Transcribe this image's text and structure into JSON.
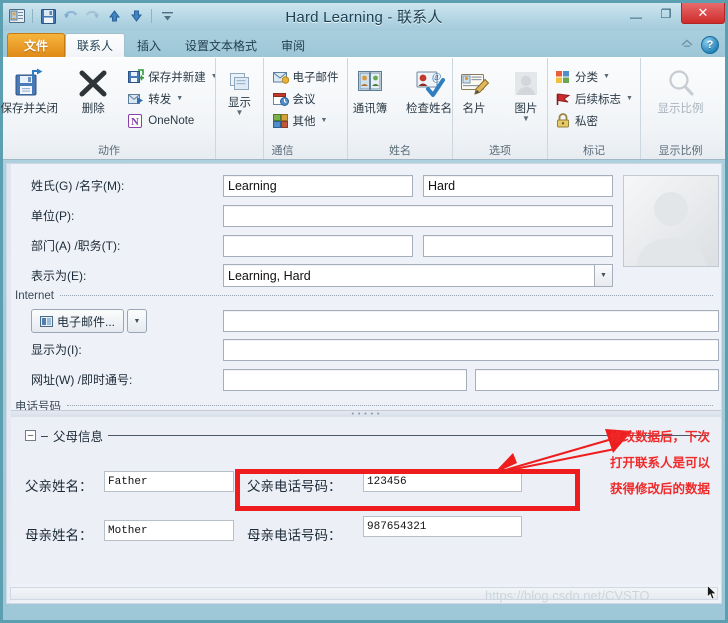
{
  "window": {
    "title": "Hard Learning - 联系人",
    "minimize_label": "—",
    "maximize_label": "❐",
    "close_label": "✕"
  },
  "quick_access": {
    "icons": [
      "contact-card-icon",
      "save-icon",
      "undo-icon",
      "redo-icon",
      "up-arrow-icon",
      "down-arrow-icon",
      "customize-qat-icon"
    ]
  },
  "tabs": [
    {
      "label": "文件",
      "kind": "file"
    },
    {
      "label": "联系人",
      "kind": "active"
    },
    {
      "label": "插入",
      "kind": "normal"
    },
    {
      "label": "设置文本格式",
      "kind": "normal"
    },
    {
      "label": "审阅",
      "kind": "normal"
    }
  ],
  "tab_right": {
    "minimize_ribbon_icon": "minimize-ribbon-icon",
    "help_label": "?"
  },
  "ribbon": {
    "groups": [
      {
        "name": "动作",
        "big_buttons": [
          {
            "label": "保存并关闭",
            "icon": "save-and-close-icon"
          },
          {
            "label": "删除",
            "icon": "delete-x-icon"
          }
        ],
        "small_buttons": [
          {
            "label": "保存并新建",
            "icon": "save-new-icon",
            "caret": true
          },
          {
            "label": "转发",
            "icon": "forward-icon",
            "caret": true
          },
          {
            "label": "OneNote",
            "icon": "onenote-icon",
            "caret": false
          }
        ]
      },
      {
        "name": "通信",
        "big_buttons": [
          {
            "label": "显示",
            "icon": "show-icon",
            "caret": true
          }
        ],
        "small_buttons": [
          {
            "label": "电子邮件",
            "icon": "email-icon",
            "caret": false
          },
          {
            "label": "会议",
            "icon": "meeting-icon",
            "caret": false
          },
          {
            "label": "其他",
            "icon": "more-icon",
            "caret": true
          }
        ]
      },
      {
        "name": "姓名",
        "big_buttons": [
          {
            "label": "通讯簿",
            "icon": "address-book-icon"
          },
          {
            "label": "检查姓名",
            "icon": "check-names-icon"
          }
        ],
        "small_buttons": []
      },
      {
        "name": "选项",
        "big_buttons": [
          {
            "label": "名片",
            "icon": "business-card-icon"
          },
          {
            "label": "图片",
            "icon": "picture-icon",
            "caret": true
          }
        ],
        "small_buttons": []
      },
      {
        "name": "标记",
        "big_buttons": [],
        "small_buttons": [
          {
            "label": "分类",
            "icon": "categorize-icon",
            "caret": true
          },
          {
            "label": "后续标志",
            "icon": "follow-up-flag-icon",
            "caret": true
          },
          {
            "label": "私密",
            "icon": "private-lock-icon",
            "caret": false
          }
        ]
      },
      {
        "name": "显示比例",
        "big_buttons": [
          {
            "label": "显示比例",
            "icon": "zoom-magnifier-icon",
            "dim": true
          }
        ],
        "small_buttons": []
      }
    ]
  },
  "form": {
    "fields": {
      "name_label": "姓氏(G)  /名字(M):",
      "last_name": "Learning",
      "first_name": "Hard",
      "company_label": "单位(P):",
      "company": "",
      "dept_label": "部门(A)  /职务(T):",
      "department": "",
      "job_title": "",
      "display_as_label": "表示为(E):",
      "display_as": "Learning, Hard"
    },
    "internet": {
      "section_label": "Internet",
      "email_button": "电子邮件...",
      "email_value": "",
      "display_as_label": "显示为(I):",
      "display_as_value": "",
      "web_im_label": "网址(W)  /即时通号:",
      "web_page": "",
      "im_address": ""
    },
    "phone_section_label": "电话号码",
    "photo_alt": "contact-photo-placeholder"
  },
  "custom_section": {
    "expander": "–",
    "dash": "–",
    "title": "父母信息",
    "father_name_label": "父亲姓名：",
    "father_name_value": "Father",
    "father_phone_label": "父亲电话号码：",
    "father_phone_value": "123456",
    "mother_name_label": "母亲姓名：",
    "mother_name_value": "Mother",
    "mother_phone_label": "母亲电话号码：",
    "mother_phone_value": "987654321"
  },
  "annotation": {
    "lines": [
      "修改数据后，下次",
      "打开联系人是可以",
      "获得修改后的数据"
    ],
    "color": "#ef2a2a",
    "highlight_color": "#ee1c1c"
  },
  "watermark": {
    "text": "https://blog.csdn.net/CVSTO"
  }
}
